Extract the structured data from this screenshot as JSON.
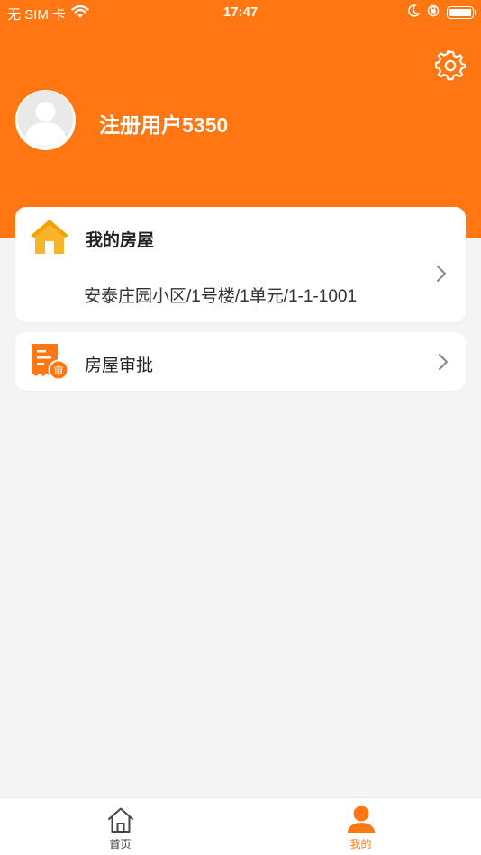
{
  "status_bar": {
    "carrier": "无 SIM 卡",
    "time": "17:47"
  },
  "profile": {
    "username": "注册用户5350"
  },
  "my_house": {
    "title": "我的房屋",
    "address": "安泰庄园小区/1号楼/1单元/1-1-1001"
  },
  "approval": {
    "label": "房屋审批",
    "icon_badge": "审"
  },
  "tabs": [
    {
      "label": "首页",
      "icon": "home-icon",
      "active": false
    },
    {
      "label": "我的",
      "icon": "person-icon",
      "active": true
    }
  ],
  "colors": {
    "accent": "#ff7712",
    "house_icon": "#f8b52c",
    "background": "#f4f4f4"
  }
}
